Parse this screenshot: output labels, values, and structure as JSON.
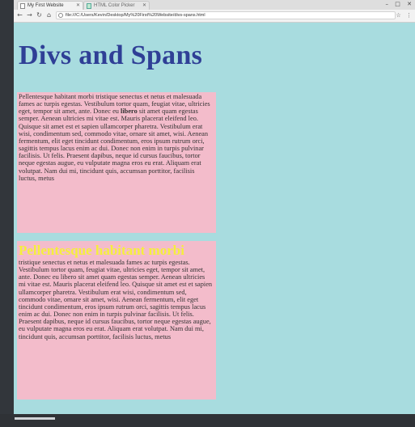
{
  "browser": {
    "tabs": [
      {
        "title": "My First Website",
        "active": true
      },
      {
        "title": "HTML Color Picker",
        "active": false
      }
    ],
    "address": "file:///C:/Users/Kevin/Desktop/My%20First%20Website/divs-spans.html",
    "window_controls": [
      "–",
      "□",
      "✕"
    ]
  },
  "page": {
    "title": "Divs and Spans",
    "div1": {
      "text_before": "Pellentesque habitant morbi tristique senectus et netus et malesuada fames ac turpis egestas. Vestibulum tortor quam, feugiat vitae, ultricies eget, tempor sit amet, ante. Donec eu ",
      "bold": "libero",
      "text_after": " sit amet quam egestas semper. Aenean ultricies mi vitae est. Mauris placerat eleifend leo. Quisque sit amet est et sapien ullamcorper pharetra. Vestibulum erat wisi, condimentum sed, commodo vitae, ornare sit amet, wisi. Aenean fermentum, elit eget tincidunt condimentum, eros ipsum rutrum orci, sagittis tempus lacus enim ac dui. Donec non enim in turpis pulvinar facilisis. Ut felis. Praesent dapibus, neque id cursus faucibus, tortor neque egestas augue, eu vulputate magna eros eu erat. Aliquam erat volutpat. Nam dui mi, tincidunt quis, accumsan porttitor, facilisis luctus, metus"
    },
    "div2": {
      "heading": "Pellentesque habitant morbi",
      "text": "tristique senectus et netus et malesuada fames ac turpis egestas. Vestibulum tortor quam, feugiat vitae, ultricies eget, tempor sit amet, ante. Donec eu libero sit amet quam egestas semper. Aenean ultricies mi vitae est. Mauris placerat eleifend leo. Quisque sit amet est et sapien ullamcorper pharetra. Vestibulum erat wisi, condimentum sed, commodo vitae, ornare sit amet, wisi. Aenean fermentum, elit eget tincidunt condimentum, eros ipsum rutrum orci, sagittis tempus lacus enim ac dui. Donec non enim in turpis pulvinar facilisis. Ut felis. Praesent dapibus, neque id cursus faucibus, tortor neque egestas augue, eu vulputate magna eros eu erat. Aliquam erat volutpat. Nam dui mi, tincidunt quis, accumsan porttitor, facilisis luctus, metus"
    }
  },
  "colors": {
    "page_background": "#a8dcdf",
    "title": "#2f3f96",
    "div_background": "#f3bccb",
    "span_heading": "#f5ef3c"
  },
  "icons": {
    "back": "arrow-left-icon",
    "forward": "arrow-right-icon",
    "reload": "reload-icon",
    "home": "home-icon",
    "page_info": "file-icon",
    "bookmark": "star-icon",
    "menu": "kebab-menu-icon"
  }
}
